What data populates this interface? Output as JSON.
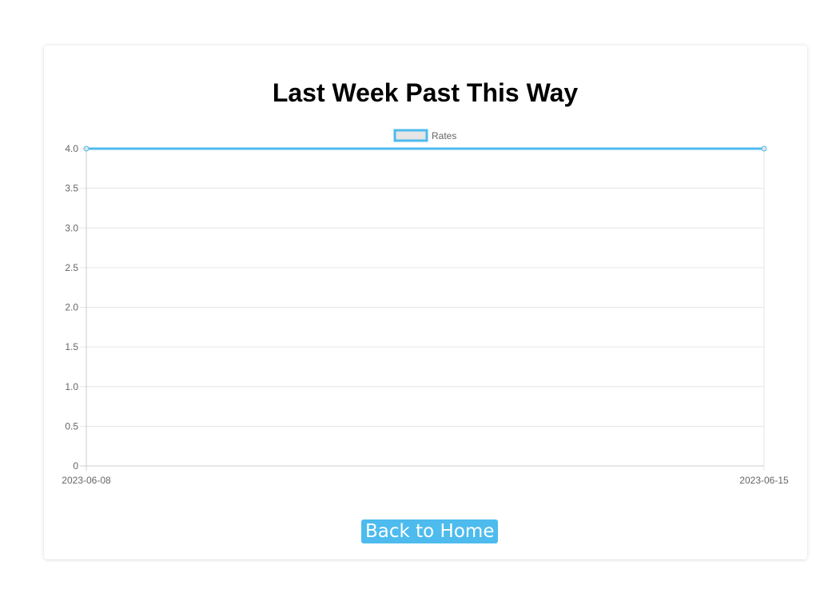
{
  "page": {
    "title": "Last Week Past This Way"
  },
  "chart_data": {
    "type": "line",
    "x": [
      "2023-06-08",
      "2023-06-15"
    ],
    "series": [
      {
        "name": "Rates",
        "values": [
          4.0,
          4.0
        ]
      }
    ],
    "ylim": [
      0,
      4.0
    ],
    "yticks": [
      "0",
      "0.5",
      "1.0",
      "1.5",
      "2.0",
      "2.5",
      "3.0",
      "3.5",
      "4.0"
    ],
    "grid": true,
    "legend_position": "top-center",
    "colors": {
      "line": "#4dbbed",
      "legend_fill": "#e5e5e5",
      "grid": "#e6e6e6"
    }
  },
  "actions": {
    "back_label": "Back to Home"
  }
}
